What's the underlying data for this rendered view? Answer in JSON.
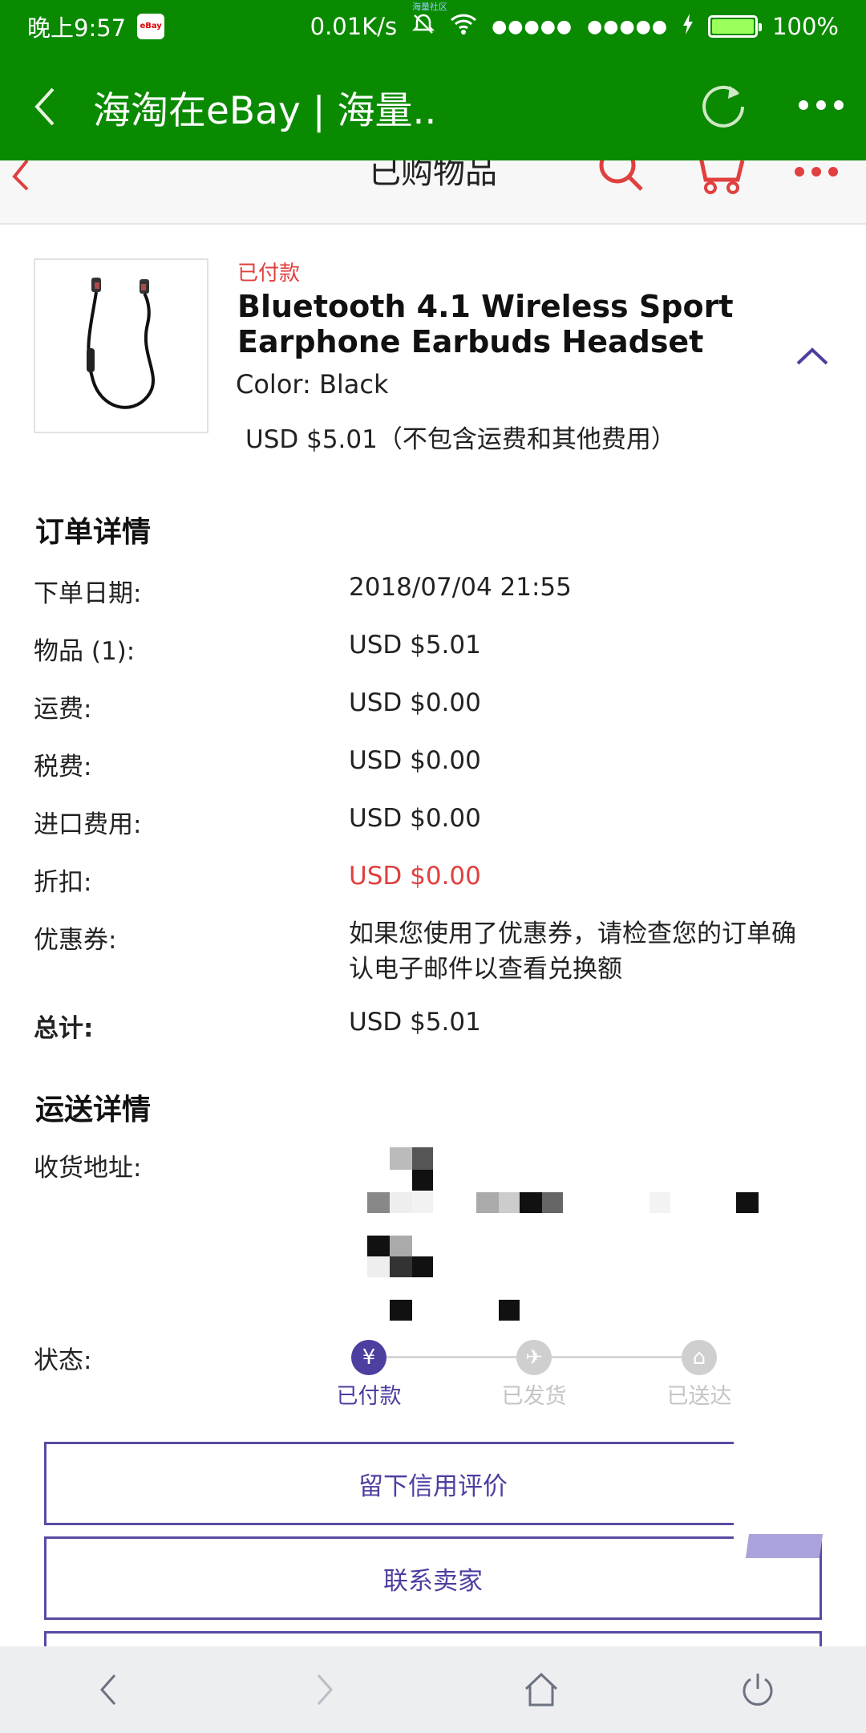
{
  "status_bar": {
    "time": "晚上9:57",
    "network_speed": "0.01K/s",
    "signal_1": "●●●●●",
    "signal_2": "●●●●●",
    "battery": "100%",
    "carrier_note": "海量社区"
  },
  "app_bar": {
    "title": "海淘在eBay | 海量.."
  },
  "web_header": {
    "title": "已购物品"
  },
  "item": {
    "status": "已付款",
    "title": "Bluetooth 4.1 Wireless Sport Earphone Earbuds Headset",
    "color": "Color: Black",
    "price": "USD $5.01（不包含运费和其他费用）"
  },
  "order_details": {
    "title": "订单详情",
    "rows": [
      {
        "label": "下单日期:",
        "value": "2018/07/04 21:55"
      },
      {
        "label": "物品 (1):",
        "value": "USD $5.01"
      },
      {
        "label": "运费:",
        "value": "USD $0.00"
      },
      {
        "label": "税费:",
        "value": "USD $0.00"
      },
      {
        "label": "进口费用:",
        "value": "USD $0.00"
      },
      {
        "label": "折扣:",
        "value": "USD $0.00"
      },
      {
        "label": "优惠券:",
        "value": "如果您使用了优惠券，请检查您的订单确认电子邮件以查看兑换额"
      },
      {
        "label": "总计:",
        "value": "USD $5.01"
      }
    ]
  },
  "shipping_details": {
    "title": "运送详情",
    "address_label": "收货地址:",
    "status_label": "状态:",
    "steps": [
      "已付款",
      "已发货",
      "已送达"
    ],
    "current_step": 1
  },
  "buttons": {
    "feedback": "留下信用评价",
    "contact_seller": "联系卖家"
  },
  "colors": {
    "browser_green": "#0a8a00",
    "ebay_red": "#e0403f",
    "accent_purple": "#5b4aa3"
  }
}
